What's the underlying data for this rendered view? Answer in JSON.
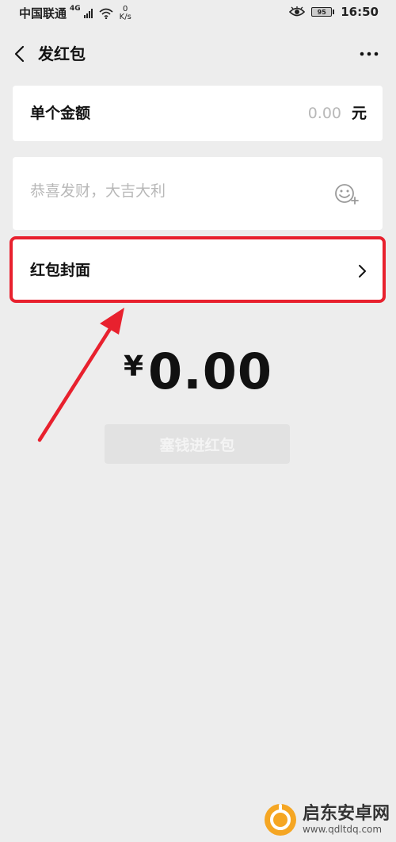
{
  "status_bar": {
    "carrier": "中国联通",
    "network_type": "4G",
    "net_speed_value": "0",
    "net_speed_unit": "K/s",
    "battery_level": "95",
    "time": "16:50"
  },
  "nav": {
    "title": "发红包"
  },
  "amount_field": {
    "label": "单个金额",
    "value": "0.00",
    "unit": "元"
  },
  "greeting_field": {
    "placeholder": "恭喜发财，大吉大利"
  },
  "cover_field": {
    "label": "红包封面"
  },
  "total": {
    "currency": "¥",
    "amount": "0.00"
  },
  "submit_button": {
    "label": "塞钱进红包"
  },
  "watermark": {
    "title": "启东安卓网",
    "url": "www.qdltdq.com"
  },
  "colors": {
    "background": "#ededed",
    "card": "#ffffff",
    "highlight_red": "#e8212e",
    "placeholder_gray": "#b8b8b8",
    "button_disabled": "#e2e2e2",
    "watermark_orange": "#f5a623"
  },
  "icons": {
    "back": "back-arrow-icon",
    "more": "more-dots-icon",
    "emoji": "emoji-add-icon",
    "chevron": "chevron-right-icon",
    "wifi": "wifi-icon",
    "eye": "eye-icon",
    "battery": "battery-icon"
  }
}
